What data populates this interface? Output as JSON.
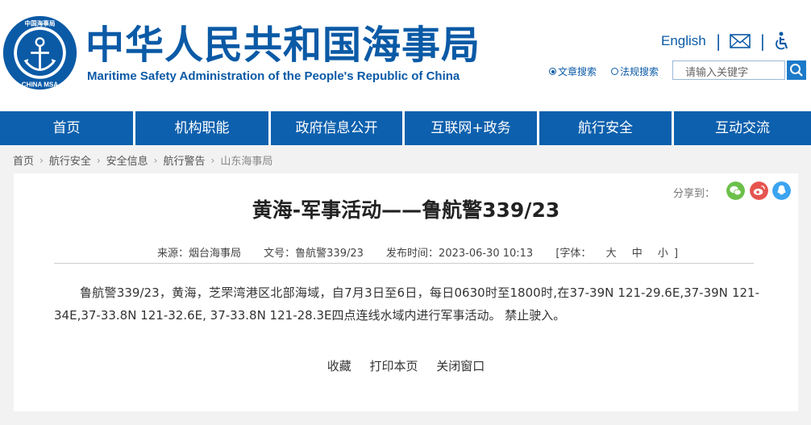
{
  "header": {
    "title": "中华人民共和国海事局",
    "subtitle": "Maritime Safety Administration of the People's Republic of China",
    "logo": {
      "text_top": "中国海事局",
      "text_bottom": "CHINA MSA"
    },
    "english_link": "English",
    "separator": "|",
    "search_options": [
      "文章搜索",
      "法规搜索"
    ],
    "search_selected": "文章搜索",
    "search_placeholder": "请输入关键字",
    "brand_color": "#0b5aa6"
  },
  "nav": {
    "items": [
      "首页",
      "机构职能",
      "政府信息公开",
      "互联网+政务",
      "航行安全",
      "互动交流"
    ],
    "bg_color": "#0d60ad"
  },
  "breadcrumb": [
    "首页",
    "航行安全",
    "安全信息",
    "航行警告",
    "山东海事局"
  ],
  "share": {
    "label": "分享到：",
    "icons": [
      "wechat-icon",
      "weibo-icon",
      "qq-icon"
    ]
  },
  "article": {
    "title": "黄海-军事活动——鲁航警339/23",
    "source": "来源：烟台海事局",
    "doc_no": "文号：鲁航警339/23",
    "published": "发布时间：2023-06-30 10:13",
    "font_label": "[字体：",
    "font_sizes": [
      "大",
      "中",
      "小"
    ],
    "font_close": "]",
    "body": "鲁航警339/23，黄海，芝罘湾港区北部海域，自7月3日至6日，每日0630时至1800时,在37-39N 121-29.6E,37-39N 121-34E,37-33.8N 121-32.6E, 37-33.8N 121-28.3E四点连线水域内进行军事活动。 禁止驶入。"
  },
  "actions": [
    "收藏",
    "打印本页",
    "关闭窗口"
  ]
}
